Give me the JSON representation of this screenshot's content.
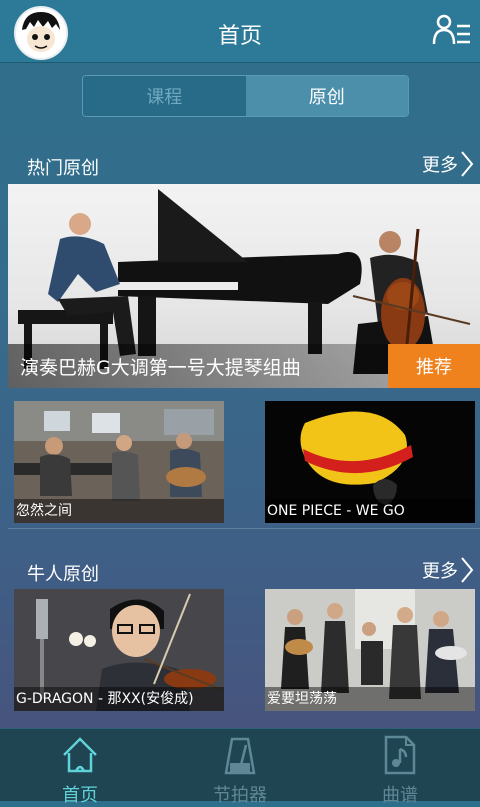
{
  "header": {
    "title": "首页"
  },
  "segmented": {
    "tabs": [
      {
        "label": "课程"
      },
      {
        "label": "原创"
      }
    ]
  },
  "sections": {
    "hot": {
      "title": "热门原创",
      "more": "更多"
    },
    "masters": {
      "title": "牛人原创",
      "more": "更多"
    }
  },
  "hero": {
    "caption": "演奏巴赫G大调第一号大提琴组曲",
    "badge": "推荐"
  },
  "tiles": [
    {
      "caption": "忽然之间"
    },
    {
      "caption": "ONE PIECE - WE GO"
    },
    {
      "caption": "G-DRAGON - 那XX(安俊成)"
    },
    {
      "caption": "爱要坦荡荡"
    }
  ],
  "tabbar": {
    "items": [
      {
        "label": "首页"
      },
      {
        "label": "节拍器"
      },
      {
        "label": "曲谱"
      }
    ]
  },
  "colors": {
    "accent": "#5fd3d8",
    "badge": "#f0821e",
    "header": "#2c7a98"
  }
}
